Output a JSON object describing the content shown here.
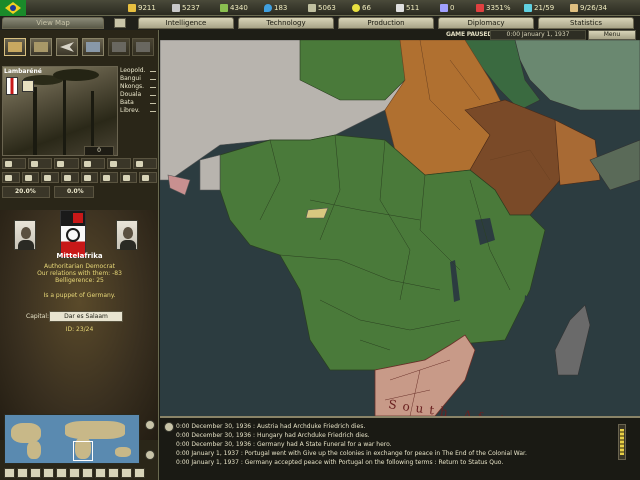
{
  "resources": [
    {
      "icon": "energy-icon",
      "value": "9211",
      "color": "#e8c040"
    },
    {
      "icon": "metal-icon",
      "value": "5237",
      "color": "#c8c8c8"
    },
    {
      "icon": "rare-materials-icon",
      "value": "4340",
      "color": "#8ac050"
    },
    {
      "icon": "oil-icon",
      "value": "183",
      "color": "#40a0e0"
    },
    {
      "icon": "supplies-icon",
      "value": "5063",
      "color": "#c0c0a0"
    },
    {
      "icon": "money-icon",
      "value": "66",
      "color": "#e8e040"
    },
    {
      "icon": "manpower-icon",
      "value": "511",
      "color": "#e0e0e0"
    },
    {
      "icon": "transport-icon",
      "value": "0",
      "color": "#a0a0ff"
    },
    {
      "icon": "dissent-icon",
      "value": "3351%",
      "color": "#e04040"
    },
    {
      "icon": "research-icon",
      "value": "21/59",
      "color": "#60d0e0"
    },
    {
      "icon": "convoy-icon",
      "value": "9/26/34",
      "color": "#e0c080"
    }
  ],
  "tabs": {
    "view_map": "View Map",
    "intelligence": "Intelligence",
    "technology": "Technology",
    "production": "Production",
    "diplomacy": "Diplomacy",
    "statistics": "Statistics"
  },
  "status": {
    "game_paused": "GAME PAUSED",
    "date": "0:00 January 1, 1937",
    "menu": "Menu"
  },
  "province": {
    "name": "Lambaréné",
    "cities": [
      "Leopold.",
      "Bangui",
      "Nkongs.",
      "Douala",
      "Bata",
      "Librev."
    ],
    "slot_value": "0",
    "icons_row1": [
      "factory-icon",
      "infrastructure-icon",
      "aa-icon",
      "airbase-icon",
      "naval-base-icon",
      "radar-icon"
    ],
    "icons_row2": [
      "energy-icon",
      "metal-icon",
      "rare-icon",
      "oil-icon",
      "coastal-fort-icon",
      "land-fort-icon",
      "supply-icon",
      "unit-icon"
    ],
    "pct_left": "20.0%",
    "pct_right": "0.0%"
  },
  "nation": {
    "name": "Mittelafrika",
    "government": "Authoritarian Democrat",
    "relations": "Our relations with them: -83",
    "belligerence": "Belligerence: 25",
    "puppet": "Is a puppet of Germany.",
    "capital_label": "Capital:",
    "capital": "Dar es Salaam",
    "id": "ID: 23/24"
  },
  "log": [
    "0:00 December 30, 1936 : Austria had Archduke Friedrich dies.",
    "0:00 December 30, 1936 : Hungary had Archduke Friedrich dies.",
    "0:00 December 30, 1936 : Germany had A State Funeral for a war hero.",
    "0:00 January 1, 1937 : Portugal went with Give up the colonies in exchange for peace in The End of the Colonial War.",
    "0:00 January 1, 1937 : Germany accepted peace with Portugal on the following terms : Return to Status Quo."
  ],
  "map_label": "South Africa",
  "colors": {
    "mittelafrika": "#4a7a3a",
    "italy_colony": "#b07030",
    "ethiopia": "#7a4a28",
    "south_africa": "#c89a88",
    "sea": "#2c3c40"
  }
}
